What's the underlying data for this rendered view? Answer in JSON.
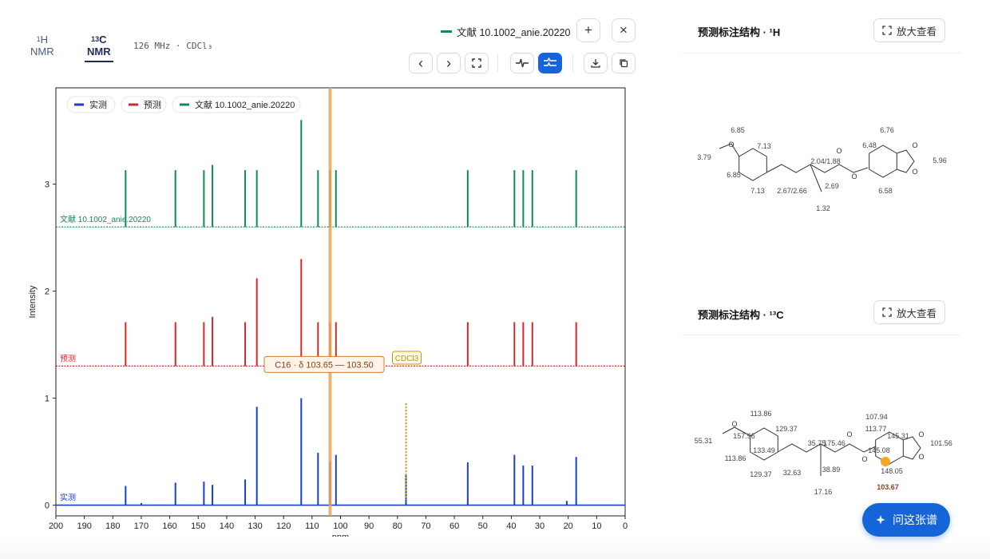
{
  "tabs": [
    {
      "sup": "1",
      "label": "H",
      "sub": "NMR"
    },
    {
      "sup": "13",
      "label": "C",
      "sub": "NMR",
      "active": true
    }
  ],
  "frequency": "126 MHz · CDCl₃",
  "reference": {
    "label": "文献 10.1002_anie.20220",
    "color": "#0e8a5a"
  },
  "toolbar": {
    "add": "+",
    "close": "×",
    "prev": "‹",
    "next": "›"
  },
  "chart_data": {
    "type": "line",
    "xlabel": "ppm",
    "ylabel": "Intensity",
    "xlim": [
      200,
      0
    ],
    "ylim": [
      -0.1,
      3.9
    ],
    "xticks": [
      200,
      190,
      180,
      170,
      160,
      150,
      140,
      130,
      120,
      110,
      100,
      90,
      80,
      70,
      60,
      50,
      40,
      30,
      20,
      10,
      0
    ],
    "yticks": [
      0,
      1,
      2,
      3
    ],
    "legend": [
      {
        "name": "实测",
        "color": "#1a3fc4"
      },
      {
        "name": "预测",
        "color": "#cc2b2b"
      },
      {
        "name": "文献 10.1002_anie.20220",
        "color": "#0e8a5a"
      }
    ],
    "series": [
      {
        "name": "实测",
        "color": "#1a3fc4",
        "baseline": 0,
        "peaks": [
          [
            175.5,
            0.18
          ],
          [
            170,
            0.02
          ],
          [
            158,
            0.21
          ],
          [
            148,
            0.22
          ],
          [
            145,
            0.19
          ],
          [
            133.5,
            0.24
          ],
          [
            129.4,
            0.92
          ],
          [
            113.8,
            1.0
          ],
          [
            107.9,
            0.49
          ],
          [
            103.7,
            0.41
          ],
          [
            101.6,
            0.47
          ],
          [
            77,
            0.28
          ],
          [
            55.3,
            0.4
          ],
          [
            38.9,
            0.47
          ],
          [
            35.8,
            0.37
          ],
          [
            32.6,
            0.37
          ],
          [
            20.5,
            0.04
          ],
          [
            17.2,
            0.45
          ]
        ]
      },
      {
        "name": "预测",
        "color": "#cc2b2b",
        "baseline": 1.3,
        "peaks": [
          [
            175.5,
            0.41
          ],
          [
            158,
            0.41
          ],
          [
            148,
            0.41
          ],
          [
            145,
            0.46
          ],
          [
            133.5,
            0.41
          ],
          [
            129.4,
            0.82
          ],
          [
            113.8,
            1.0
          ],
          [
            107.9,
            0.41
          ],
          [
            103.7,
            0.41
          ],
          [
            101.6,
            0.41
          ],
          [
            55.3,
            0.41
          ],
          [
            38.9,
            0.41
          ],
          [
            35.8,
            0.41
          ],
          [
            32.6,
            0.41
          ],
          [
            17.2,
            0.41
          ]
        ]
      },
      {
        "name": "文献 10.1002_anie.20220",
        "color": "#0e8a5a",
        "baseline": 2.6,
        "peaks": [
          [
            175.5,
            0.53
          ],
          [
            158,
            0.53
          ],
          [
            148,
            0.53
          ],
          [
            145,
            0.58
          ],
          [
            133.5,
            0.53
          ],
          [
            129.4,
            0.53
          ],
          [
            113.8,
            1.0
          ],
          [
            107.9,
            0.53
          ],
          [
            103.7,
            0.53
          ],
          [
            101.6,
            0.53
          ],
          [
            55.3,
            0.53
          ],
          [
            38.9,
            0.53
          ],
          [
            35.8,
            0.53
          ],
          [
            32.6,
            0.53
          ],
          [
            17.2,
            0.53
          ]
        ]
      }
    ],
    "highlight": {
      "ppm": 103.65,
      "label": "C16 · δ 103.65 — 103.50",
      "color": "#e7a55c"
    },
    "solvent": {
      "ppm": 77,
      "label": "CDCl3",
      "color": "#c9950a"
    }
  },
  "panels": [
    {
      "title": "预测标注结构 · ¹H",
      "button": "放大查看",
      "labels": [
        "6.85",
        "7.13",
        "3.79",
        "6.85",
        "7.13",
        "2.04/1.88",
        "2.67/2.66",
        "2.69",
        "1.32",
        "6.76",
        "6.48",
        "5.96",
        "6.58"
      ]
    },
    {
      "title": "预测标注结构 · ¹³C",
      "button": "放大查看",
      "labels": [
        "113.86",
        "129.37",
        "157.96",
        "55.31",
        "133.49",
        "113.86",
        "129.37",
        "32.63",
        "35.75",
        "38.89",
        "17.16",
        "175.46",
        "113.77",
        "107.94",
        "145.31",
        "145.08",
        "101.56",
        "148.05",
        "103.67"
      ]
    }
  ],
  "ask_button": "问这张谱"
}
